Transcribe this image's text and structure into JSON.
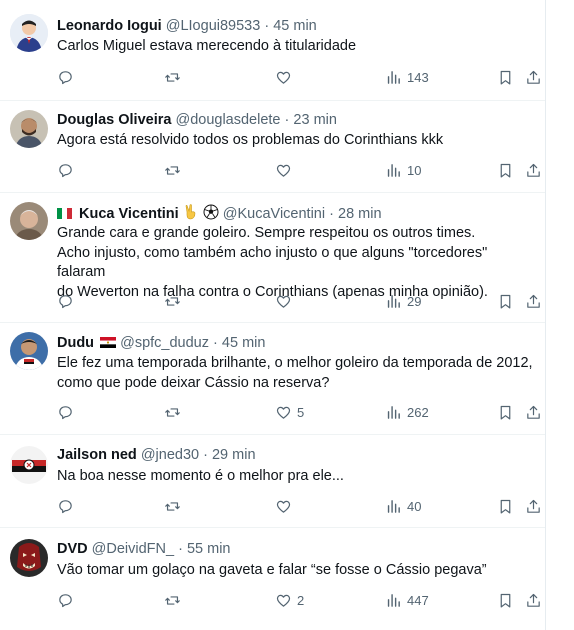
{
  "tweets": [
    {
      "name": "Leonardo Iogui",
      "handle": "@LIogui89533",
      "time": "45 min",
      "lines": [
        "Carlos Miguel estava merecendo à titularidade"
      ],
      "likes": "",
      "views": "143"
    },
    {
      "name": "Douglas Oliveira",
      "handle": "@douglasdelete",
      "time": "23 min",
      "lines": [
        "Agora está resolvido todos os problemas do Corinthians kkk"
      ],
      "likes": "",
      "views": "10"
    },
    {
      "name": "Kuca Vicentini",
      "handle": "@KucaVicentini",
      "time": "28 min",
      "lines": [
        "Grande cara e grande goleiro. Sempre respeitou os outros times.",
        "Acho injusto, como também acho injusto o que alguns \"torcedores\" falaram",
        "do Weverton na falha contra o Corinthians (apenas minha opinião)."
      ],
      "likes": "",
      "views": "29"
    },
    {
      "name": "Dudu",
      "handle": "@spfc_duduz",
      "time": "45 min",
      "lines": [
        "Ele fez uma temporada brilhante, o melhor goleiro da temporada de 2012,",
        "como que pode deixar Cássio na reserva?"
      ],
      "likes": "5",
      "views": "262"
    },
    {
      "name": "Jailson ned",
      "handle": "@jned30",
      "time": "29 min",
      "lines": [
        "Na boa nesse momento é o melhor pra ele..."
      ],
      "likes": "",
      "views": "40"
    },
    {
      "name": "DVD",
      "handle": "@DeividFN_",
      "time": "55 min",
      "lines": [
        "Vão tomar um golaço na gaveta e falar “se fosse o Cássio pegava”"
      ],
      "likes": "2",
      "views": "447"
    }
  ],
  "separator": "·",
  "colors": {
    "text": "#0f1419",
    "meta": "#536471",
    "border": "#eff3f4"
  },
  "icons": [
    "reply-icon",
    "retweet-icon",
    "like-icon",
    "views-icon",
    "bookmark-icon",
    "share-icon"
  ]
}
